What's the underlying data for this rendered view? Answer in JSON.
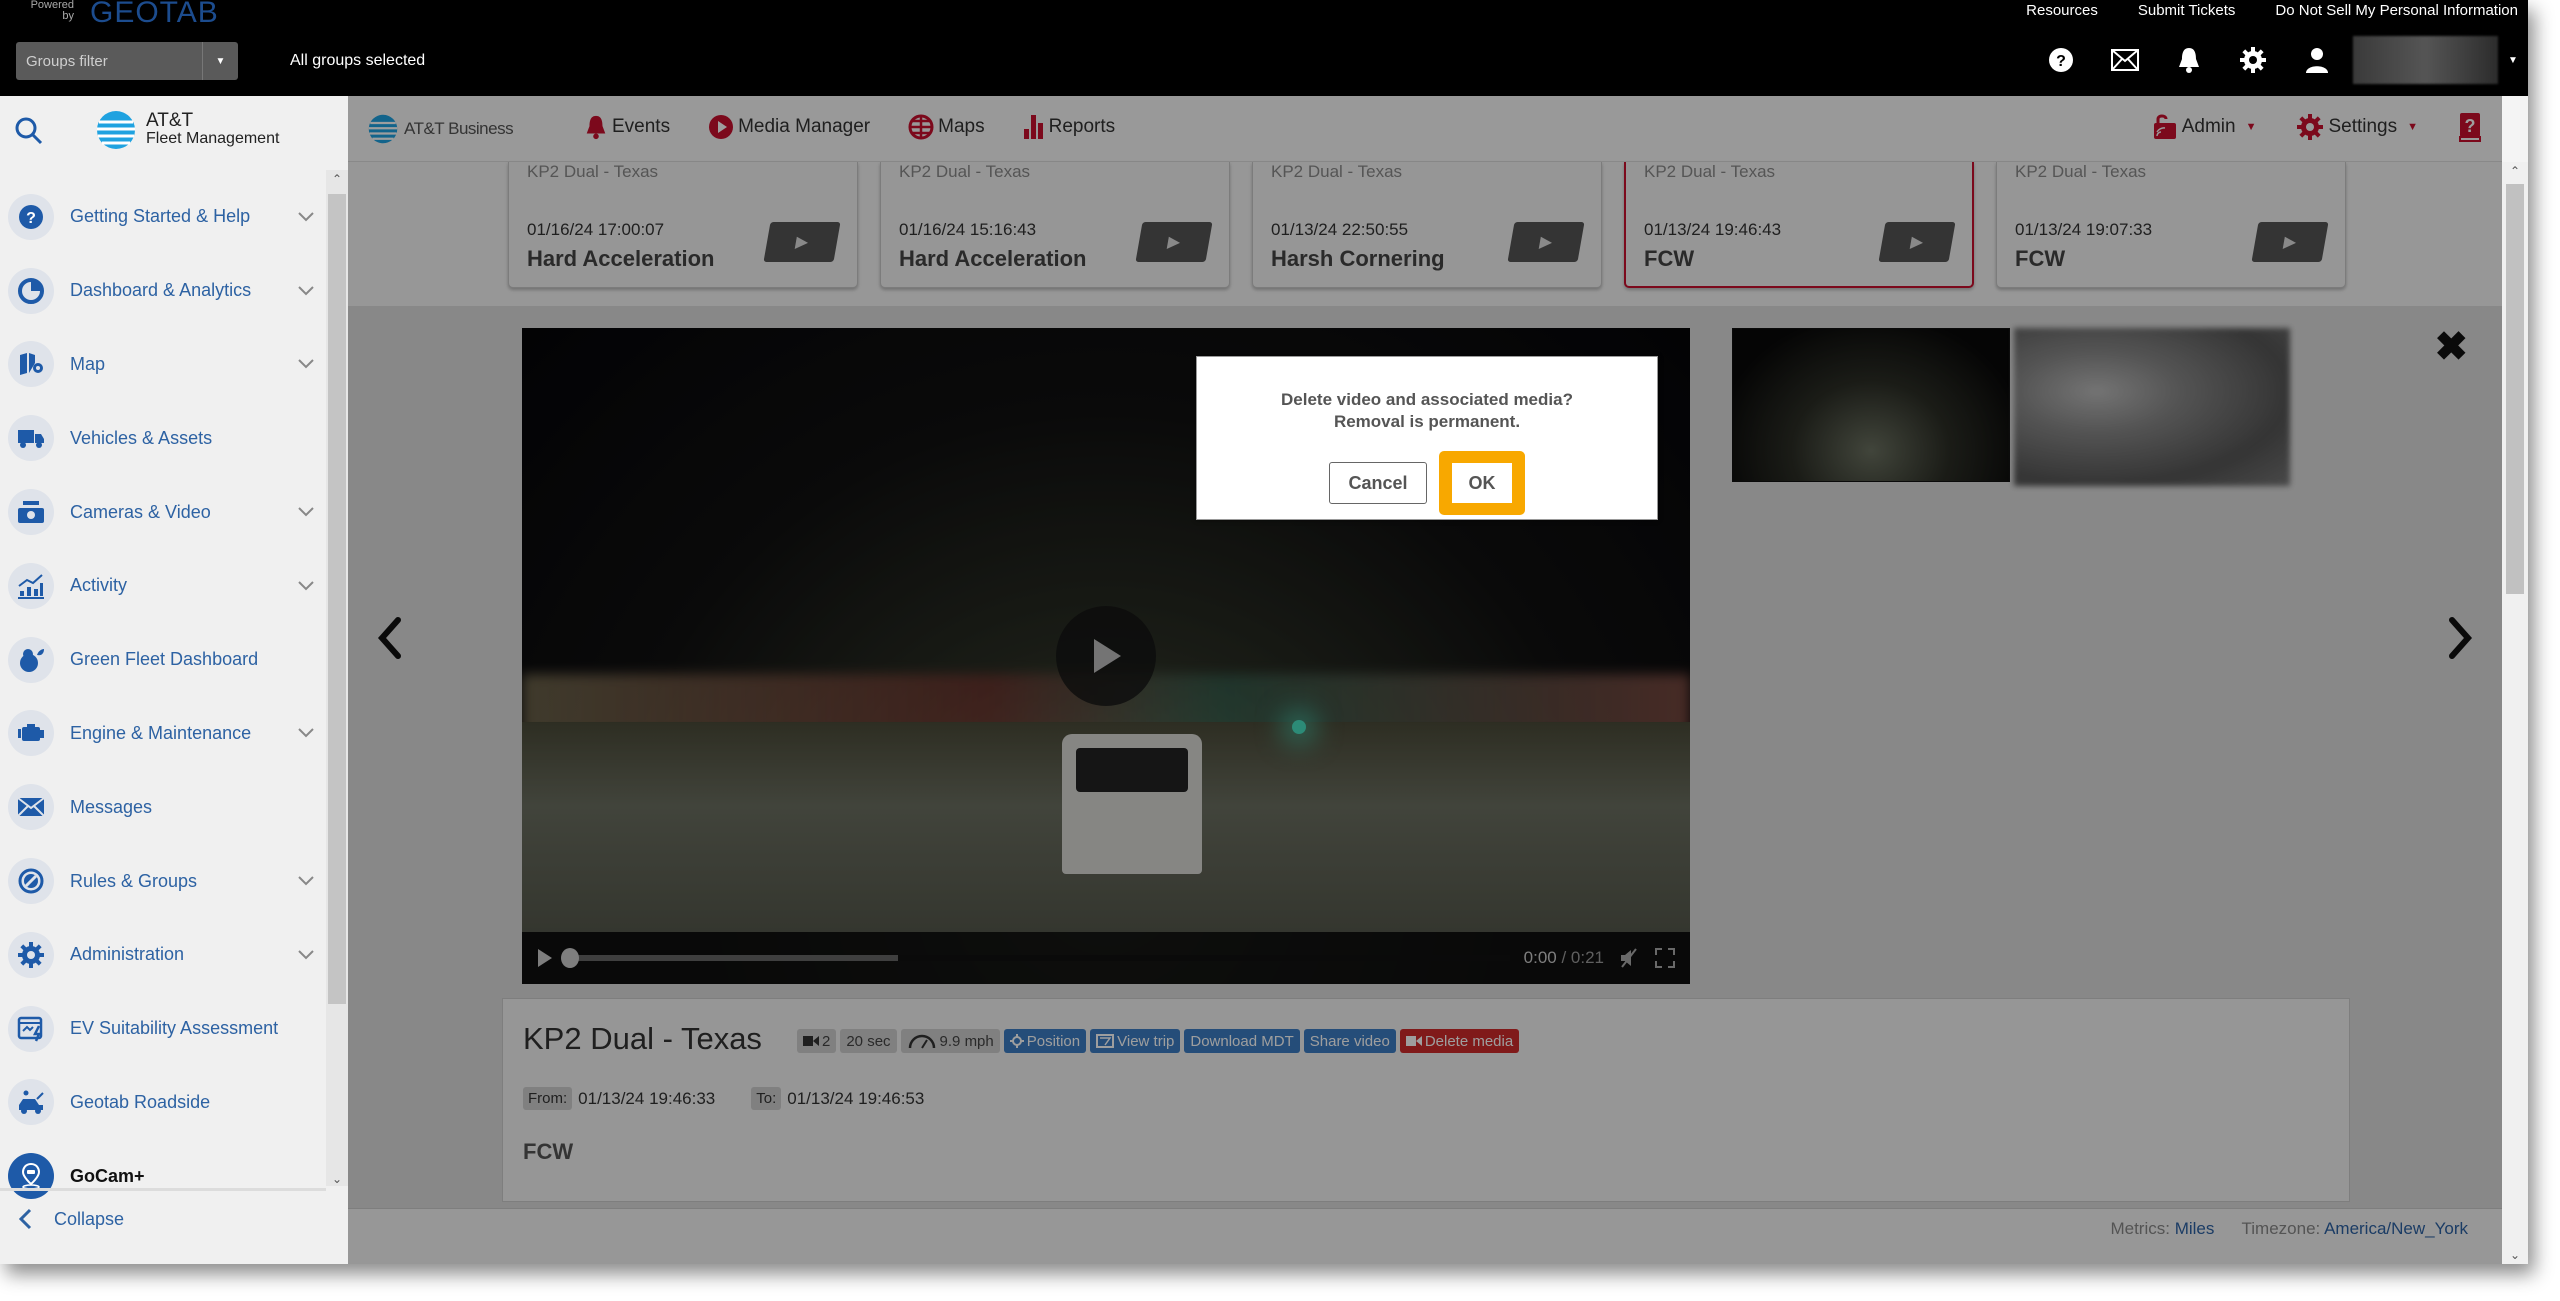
{
  "topbar": {
    "powered_by": "Powered by",
    "brand": "GEOTAB",
    "groups_filter_placeholder": "Groups filter",
    "groups_status": "All groups selected",
    "links": [
      "Resources",
      "Submit Tickets",
      "Do Not Sell My Personal Information"
    ],
    "icons": [
      "help-icon",
      "mail-icon",
      "bell-icon",
      "gear-icon",
      "user-icon"
    ]
  },
  "sidebar": {
    "brand_line1": "AT&T",
    "brand_line2": "Fleet Management",
    "items": [
      {
        "label": "Getting Started & Help",
        "icon": "help-circle-icon",
        "expandable": true
      },
      {
        "label": "Dashboard & Analytics",
        "icon": "pie-chart-icon",
        "expandable": true
      },
      {
        "label": "Map",
        "icon": "map-icon",
        "expandable": true
      },
      {
        "label": "Vehicles & Assets",
        "icon": "truck-icon",
        "expandable": false
      },
      {
        "label": "Cameras & Video",
        "icon": "camera-icon",
        "expandable": true
      },
      {
        "label": "Activity",
        "icon": "activity-chart-icon",
        "expandable": true
      },
      {
        "label": "Green Fleet Dashboard",
        "icon": "green-fleet-icon",
        "expandable": false
      },
      {
        "label": "Engine & Maintenance",
        "icon": "engine-icon",
        "expandable": true
      },
      {
        "label": "Messages",
        "icon": "envelope-icon",
        "expandable": false
      },
      {
        "label": "Rules & Groups",
        "icon": "rules-icon",
        "expandable": true
      },
      {
        "label": "Administration",
        "icon": "gear-icon",
        "expandable": true
      },
      {
        "label": "EV Suitability Assessment",
        "icon": "ev-icon",
        "expandable": false
      },
      {
        "label": "Geotab Roadside",
        "icon": "roadside-icon",
        "expandable": false
      },
      {
        "label": "GoCam+",
        "icon": "location-pin-icon",
        "expandable": false,
        "active": true
      }
    ],
    "collapse_label": "Collapse"
  },
  "navbar": {
    "brand": "AT&T Business",
    "items": [
      {
        "label": "Events",
        "icon": "bell-icon"
      },
      {
        "label": "Media Manager",
        "icon": "play-circle-icon"
      },
      {
        "label": "Maps",
        "icon": "globe-icon"
      },
      {
        "label": "Reports",
        "icon": "bar-chart-icon"
      }
    ],
    "admin": "Admin",
    "settings": "Settings",
    "accent": "#c8102e"
  },
  "event_cards": [
    {
      "vehicle": "KP2 Dual - Texas",
      "datetime": "01/16/24 17:00:07",
      "type": "Hard Acceleration",
      "selected": false
    },
    {
      "vehicle": "KP2 Dual - Texas",
      "datetime": "01/16/24 15:16:43",
      "type": "Hard Acceleration",
      "selected": false
    },
    {
      "vehicle": "KP2 Dual - Texas",
      "datetime": "01/13/24 22:50:55",
      "type": "Harsh Cornering",
      "selected": false
    },
    {
      "vehicle": "KP2 Dual - Texas",
      "datetime": "01/13/24 19:46:43",
      "type": "FCW",
      "selected": true
    },
    {
      "vehicle": "KP2 Dual - Texas",
      "datetime": "01/13/24 19:07:33",
      "type": "FCW",
      "selected": false
    }
  ],
  "player": {
    "current_time": "0:00",
    "duration": "0:21",
    "buffered_fraction": 0.35,
    "played_fraction": 0.0
  },
  "details": {
    "title": "KP2 Dual - Texas",
    "camera_count": "2",
    "length": "20 sec",
    "speed": "9.9 mph",
    "actions": [
      "Position",
      "View trip",
      "Download MDT",
      "Share video"
    ],
    "delete_label": "Delete media",
    "from_label": "From:",
    "from_value": "01/13/24 19:46:33",
    "to_label": "To:",
    "to_value": "01/13/24 19:46:53",
    "event_type": "FCW"
  },
  "footer": {
    "metrics_label": "Metrics:",
    "metrics_value": "Miles",
    "timezone_label": "Timezone:",
    "timezone_value": "America/New_York"
  },
  "dialog": {
    "line1": "Delete video and associated media?",
    "line2": "Removal is permanent.",
    "cancel": "Cancel",
    "ok": "OK",
    "highlight_color": "#f8a800"
  }
}
